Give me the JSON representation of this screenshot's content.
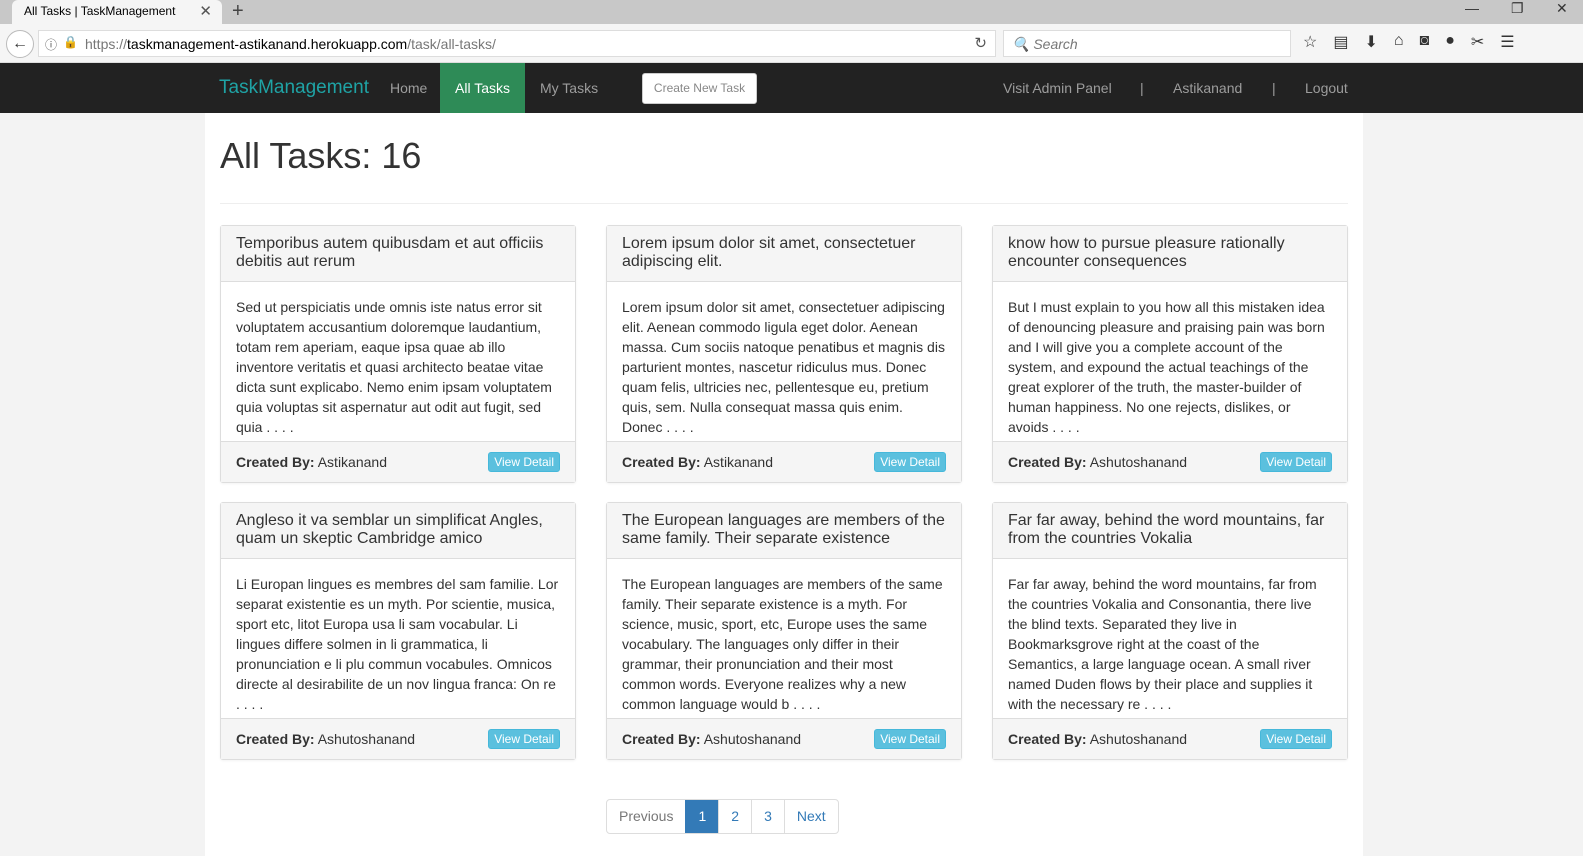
{
  "browser": {
    "tab_title": "All Tasks | TaskManagement",
    "url_host": "https://taskmanagement-astikanand.herokuapp.com",
    "url_path": "/task/all-tasks/",
    "search_placeholder": "Search"
  },
  "nav": {
    "brand": "TaskManagement",
    "home": "Home",
    "all_tasks": "All Tasks",
    "my_tasks": "My Tasks",
    "create": "Create New Task",
    "admin": "Visit Admin Panel",
    "sep": "|",
    "user": "Astikanand",
    "logout": "Logout"
  },
  "page": {
    "title": "All Tasks: 16",
    "created_by_label": "Created By:",
    "view_label": "View Detail"
  },
  "tasks": [
    {
      "title": "Temporibus autem quibusdam et aut officiis debitis aut rerum",
      "body": "Sed ut perspiciatis unde omnis iste natus error sit voluptatem accusantium doloremque laudantium, totam rem aperiam, eaque ipsa quae ab illo inventore veritatis et quasi architecto beatae vitae dicta sunt explicabo. Nemo enim ipsam voluptatem quia voluptas sit aspernatur aut odit aut fugit, sed quia . . . .",
      "author": "Astikanand"
    },
    {
      "title": "Lorem ipsum dolor sit amet, consectetuer adipiscing elit.",
      "body": "Lorem ipsum dolor sit amet, consectetuer adipiscing elit. Aenean commodo ligula eget dolor. Aenean massa. Cum sociis natoque penatibus et magnis dis parturient montes, nascetur ridiculus mus. Donec quam felis, ultricies nec, pellentesque eu, pretium quis, sem. Nulla consequat massa quis enim. Donec . . . .",
      "author": "Astikanand"
    },
    {
      "title": "know how to pursue pleasure rationally encounter consequences",
      "body": "But I must explain to you how all this mistaken idea of denouncing pleasure and praising pain was born and I will give you a complete account of the system, and expound the actual teachings of the great explorer of the truth, the master-builder of human happiness. No one rejects, dislikes, or avoids . . . .",
      "author": "Ashutoshanand"
    },
    {
      "title": "Angleso it va semblar un simplificat Angles, quam un skeptic Cambridge amico",
      "body": "Li Europan lingues es membres del sam familie. Lor separat existentie es un myth. Por scientie, musica, sport etc, litot Europa usa li sam vocabular. Li lingues differe solmen in li grammatica, li pronunciation e li plu commun vocabules. Omnicos directe al desirabilite de un nov lingua franca: On re . . . .",
      "author": "Ashutoshanand"
    },
    {
      "title": "The European languages are members of the same family. Their separate existence",
      "body": "The European languages are members of the same family. Their separate existence is a myth. For science, music, sport, etc, Europe uses the same vocabulary. The languages only differ in their grammar, their pronunciation and their most common words. Everyone realizes why a new common language would b . . . .",
      "author": "Ashutoshanand"
    },
    {
      "title": "Far far away, behind the word mountains, far from the countries Vokalia",
      "body": "Far far away, behind the word mountains, far from the countries Vokalia and Consonantia, there live the blind texts. Separated they live in Bookmarksgrove right at the coast of the Semantics, a large language ocean. A small river named Duden flows by their place and supplies it with the necessary re . . . .",
      "author": "Ashutoshanand"
    }
  ],
  "pagination": {
    "previous": "Previous",
    "pages": [
      "1",
      "2",
      "3"
    ],
    "current": "1",
    "next": "Next"
  }
}
